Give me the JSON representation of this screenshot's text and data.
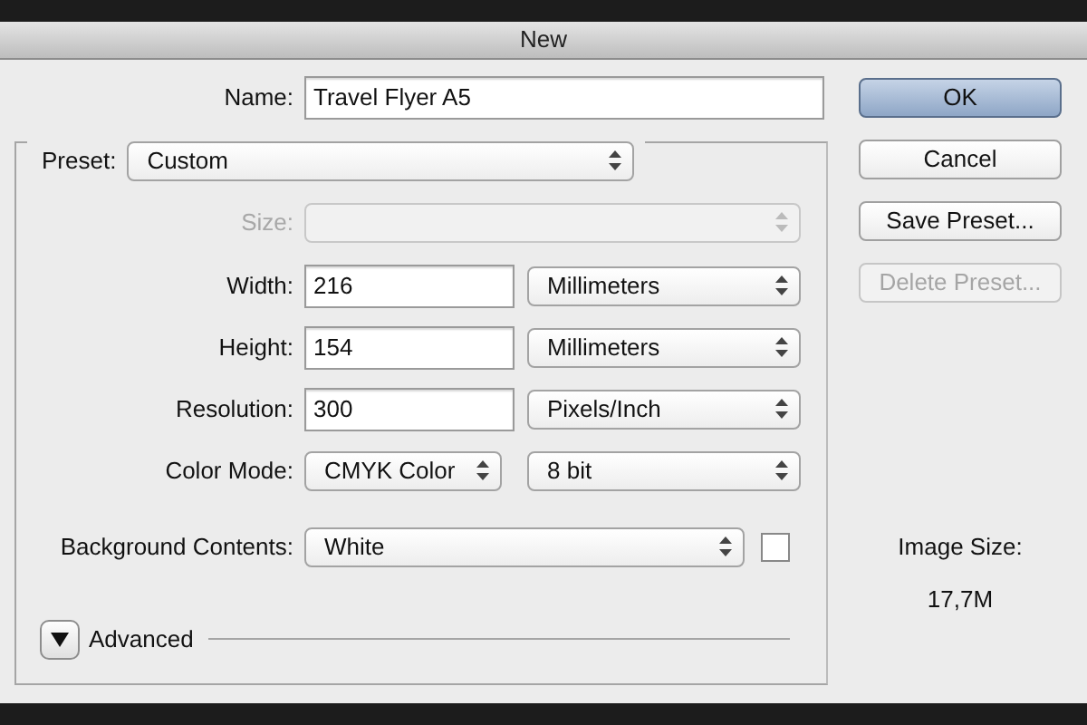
{
  "window": {
    "title": "New"
  },
  "name": {
    "label": "Name:",
    "value": "Travel Flyer A5"
  },
  "preset": {
    "label": "Preset:",
    "value": "Custom"
  },
  "fields": [
    {
      "kind": "select",
      "label": "Size:",
      "disabled": true
    },
    {
      "kind": "input_unit",
      "label": "Width:",
      "value": "216",
      "unit": "Millimeters"
    },
    {
      "kind": "input_unit",
      "label": "Height:",
      "value": "154",
      "unit": "Millimeters"
    },
    {
      "kind": "input_unit",
      "label": "Resolution:",
      "value": "300",
      "unit": "Pixels/Inch"
    },
    {
      "kind": "two_selects",
      "label": "Color Mode:",
      "value": "CMYK Color",
      "unit": "8 bit"
    },
    {
      "kind": "select_swatch",
      "label": "Background Contents:",
      "value": "White"
    }
  ],
  "advanced": {
    "label": "Advanced",
    "expanded": false
  },
  "buttons": [
    {
      "label": "OK",
      "default": true,
      "disabled": false
    },
    {
      "label": "Cancel",
      "default": false,
      "disabled": false
    },
    {
      "label": "Save Preset...",
      "default": false,
      "disabled": false
    },
    {
      "label": "Delete Preset...",
      "default": false,
      "disabled": true
    }
  ],
  "image_size": {
    "label": "Image Size:",
    "value": "17,7M"
  }
}
